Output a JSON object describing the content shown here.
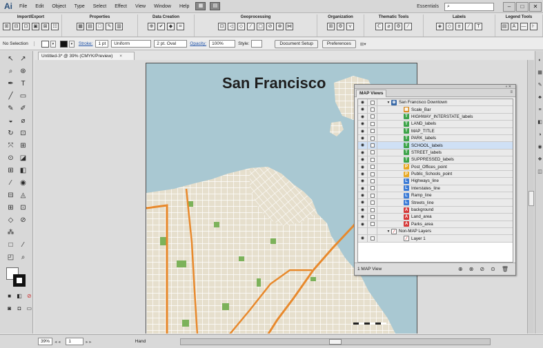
{
  "app": {
    "logo": "Ai",
    "menus": [
      "File",
      "Edit",
      "Object",
      "Type",
      "Select",
      "Effect",
      "View",
      "Window",
      "Help"
    ],
    "workspace": "Essentials",
    "search_placeholder": "",
    "window_buttons": [
      "–",
      "□",
      "✕"
    ]
  },
  "toolbar_groups": [
    {
      "title": "Import/Export",
      "icons": [
        "⊞",
        "⊟",
        "⊡",
        "▣",
        "⊠",
        "☷"
      ]
    },
    {
      "title": "Properties",
      "icons": [
        "▦",
        "▤",
        "□",
        "✎",
        "▥"
      ]
    },
    {
      "title": "Data Creation",
      "icons": [
        "⊕",
        "✔",
        "◆",
        "⌗"
      ]
    },
    {
      "title": "Geoprocessing",
      "icons": [
        "⊡",
        "◁",
        "◇",
        "⁄",
        "▢",
        "⊘",
        "⊗",
        "⋈"
      ]
    },
    {
      "title": "Organization",
      "icons": [
        "⊞",
        "⚙",
        "⋎"
      ]
    },
    {
      "title": "Thematic Tools",
      "icons": [
        "ℂ",
        "⌀",
        "⚙",
        "⁄"
      ]
    },
    {
      "title": "Labels",
      "icons": [
        "◈",
        "◇",
        "α",
        "⁄",
        "T"
      ]
    },
    {
      "title": "Legend Tools",
      "icons": [
        "▤",
        "A",
        "—",
        "⊦"
      ]
    }
  ],
  "control_bar": {
    "selection": "No Selection",
    "stroke_label": "Stroke:",
    "stroke_weight": "1 pt",
    "stroke_profile": "Uniform",
    "brush": "2 pt. Oval",
    "opacity_label": "Opacity:",
    "opacity": "100%",
    "style_label": "Style:",
    "doc_setup_button": "Document Setup",
    "preferences_button": "Preferences"
  },
  "document_tab": {
    "title": "Untitled-3* @ 39% (CMYK/Preview)",
    "close": "×"
  },
  "map": {
    "title": "San Francisco"
  },
  "tools": [
    [
      "↖",
      "↗"
    ],
    [
      "⌕",
      "⊛"
    ],
    [
      "✒",
      "T"
    ],
    [
      "╱",
      "▭"
    ],
    [
      "✎",
      "✐"
    ],
    [
      "◒",
      "⌀"
    ],
    [
      "↻",
      "⊡"
    ],
    [
      "⤧",
      "⊞"
    ],
    [
      "⊙",
      "◪"
    ],
    [
      "⊞",
      "◧"
    ],
    [
      "⁄",
      "◉"
    ],
    [
      "⊟",
      "◬"
    ],
    [
      "⊞",
      "⊡"
    ],
    [
      "◇",
      "⊘"
    ],
    [
      "⁂",
      ""
    ],
    [
      "□",
      "⁄"
    ],
    [
      "◰",
      "⌕"
    ]
  ],
  "status": {
    "zoom": "39%",
    "page": "1",
    "tool": "Hand"
  },
  "map_views_panel": {
    "tab_title": "MAP Views",
    "footer_label": "1 MAP View",
    "footer_icons": [
      "⊕",
      "⊗",
      "⊘",
      "⊙",
      "🗑"
    ],
    "layers": [
      {
        "name": "San Francisco Downtown",
        "indent": 0,
        "badge": "globe",
        "badge_text": "⊕",
        "badge_color": "#3a6aa8",
        "twirl": "▼",
        "eye": true,
        "lock": true
      },
      {
        "name": "Scale_Bar",
        "indent": 1,
        "badge": "grid",
        "badge_text": "▦",
        "badge_color": "#d88a1e",
        "twirl": "",
        "eye": true,
        "lock": true
      },
      {
        "name": "HIGHWAY_INTERSTATE_labels",
        "indent": 1,
        "badge": "text",
        "badge_text": "T",
        "badge_color": "#3ea44a",
        "twirl": "",
        "eye": true,
        "lock": true
      },
      {
        "name": "LAND_labels",
        "indent": 1,
        "badge": "text",
        "badge_text": "T",
        "badge_color": "#3ea44a",
        "twirl": "",
        "eye": true,
        "lock": true
      },
      {
        "name": "MAP_TITLE",
        "indent": 1,
        "badge": "text",
        "badge_text": "T",
        "badge_color": "#3ea44a",
        "twirl": "",
        "eye": true,
        "lock": true
      },
      {
        "name": "PARK_labels",
        "indent": 1,
        "badge": "text",
        "badge_text": "T",
        "badge_color": "#3ea44a",
        "twirl": "",
        "eye": true,
        "lock": true
      },
      {
        "name": "SCHOOL_labels",
        "indent": 1,
        "badge": "text",
        "badge_text": "T",
        "badge_color": "#3ea44a",
        "twirl": "",
        "eye": true,
        "lock": true,
        "selected": true
      },
      {
        "name": "STREET_labels",
        "indent": 1,
        "badge": "text",
        "badge_text": "T",
        "badge_color": "#3ea44a",
        "twirl": "",
        "eye": true,
        "lock": true
      },
      {
        "name": "SUPPRESSED_labels",
        "indent": 1,
        "badge": "text",
        "badge_text": "T",
        "badge_color": "#3ea44a",
        "twirl": "",
        "eye": true,
        "lock": true
      },
      {
        "name": "Post_Offices_point",
        "indent": 1,
        "badge": "point",
        "badge_text": "P",
        "badge_color": "#e8a923",
        "twirl": "",
        "eye": true,
        "lock": true
      },
      {
        "name": "Public_Schools_point",
        "indent": 1,
        "badge": "point",
        "badge_text": "P",
        "badge_color": "#e8a923",
        "twirl": "",
        "eye": true,
        "lock": true
      },
      {
        "name": "Highways_line",
        "indent": 1,
        "badge": "line",
        "badge_text": "L",
        "badge_color": "#3b7bd6",
        "twirl": "",
        "eye": true,
        "lock": true
      },
      {
        "name": "Interstates_line",
        "indent": 1,
        "badge": "line",
        "badge_text": "L",
        "badge_color": "#3b7bd6",
        "twirl": "",
        "eye": true,
        "lock": true
      },
      {
        "name": "Ramp_line",
        "indent": 1,
        "badge": "line",
        "badge_text": "L",
        "badge_color": "#3b7bd6",
        "twirl": "",
        "eye": true,
        "lock": true
      },
      {
        "name": "Streets_line",
        "indent": 1,
        "badge": "line",
        "badge_text": "L",
        "badge_color": "#3b7bd6",
        "twirl": "",
        "eye": true,
        "lock": true
      },
      {
        "name": "background",
        "indent": 1,
        "badge": "area",
        "badge_text": "A",
        "badge_color": "#d63a3a",
        "twirl": "",
        "eye": true,
        "lock": true
      },
      {
        "name": "Land_area",
        "indent": 1,
        "badge": "area",
        "badge_text": "A",
        "badge_color": "#d63a3a",
        "twirl": "",
        "eye": true,
        "lock": true
      },
      {
        "name": "Parks_area",
        "indent": 1,
        "badge": "area",
        "badge_text": "A",
        "badge_color": "#d63a3a",
        "twirl": "",
        "eye": true,
        "lock": true
      },
      {
        "name": "Non-MAP Layers",
        "indent": 0,
        "badge": "layer",
        "badge_text": "⁄",
        "badge_color": "#ffffff",
        "twirl": "▼",
        "eye": false,
        "lock": false
      },
      {
        "name": "Layer 1",
        "indent": 1,
        "badge": "layer",
        "badge_text": "⁄",
        "badge_color": "#ffffff",
        "twirl": "",
        "eye": true,
        "lock": true
      }
    ]
  },
  "colors": {
    "water": "#a9c8d2",
    "land": "#e6dfcd",
    "street": "#ffffff",
    "highway": "#e8892c",
    "park": "#7cb25a"
  }
}
